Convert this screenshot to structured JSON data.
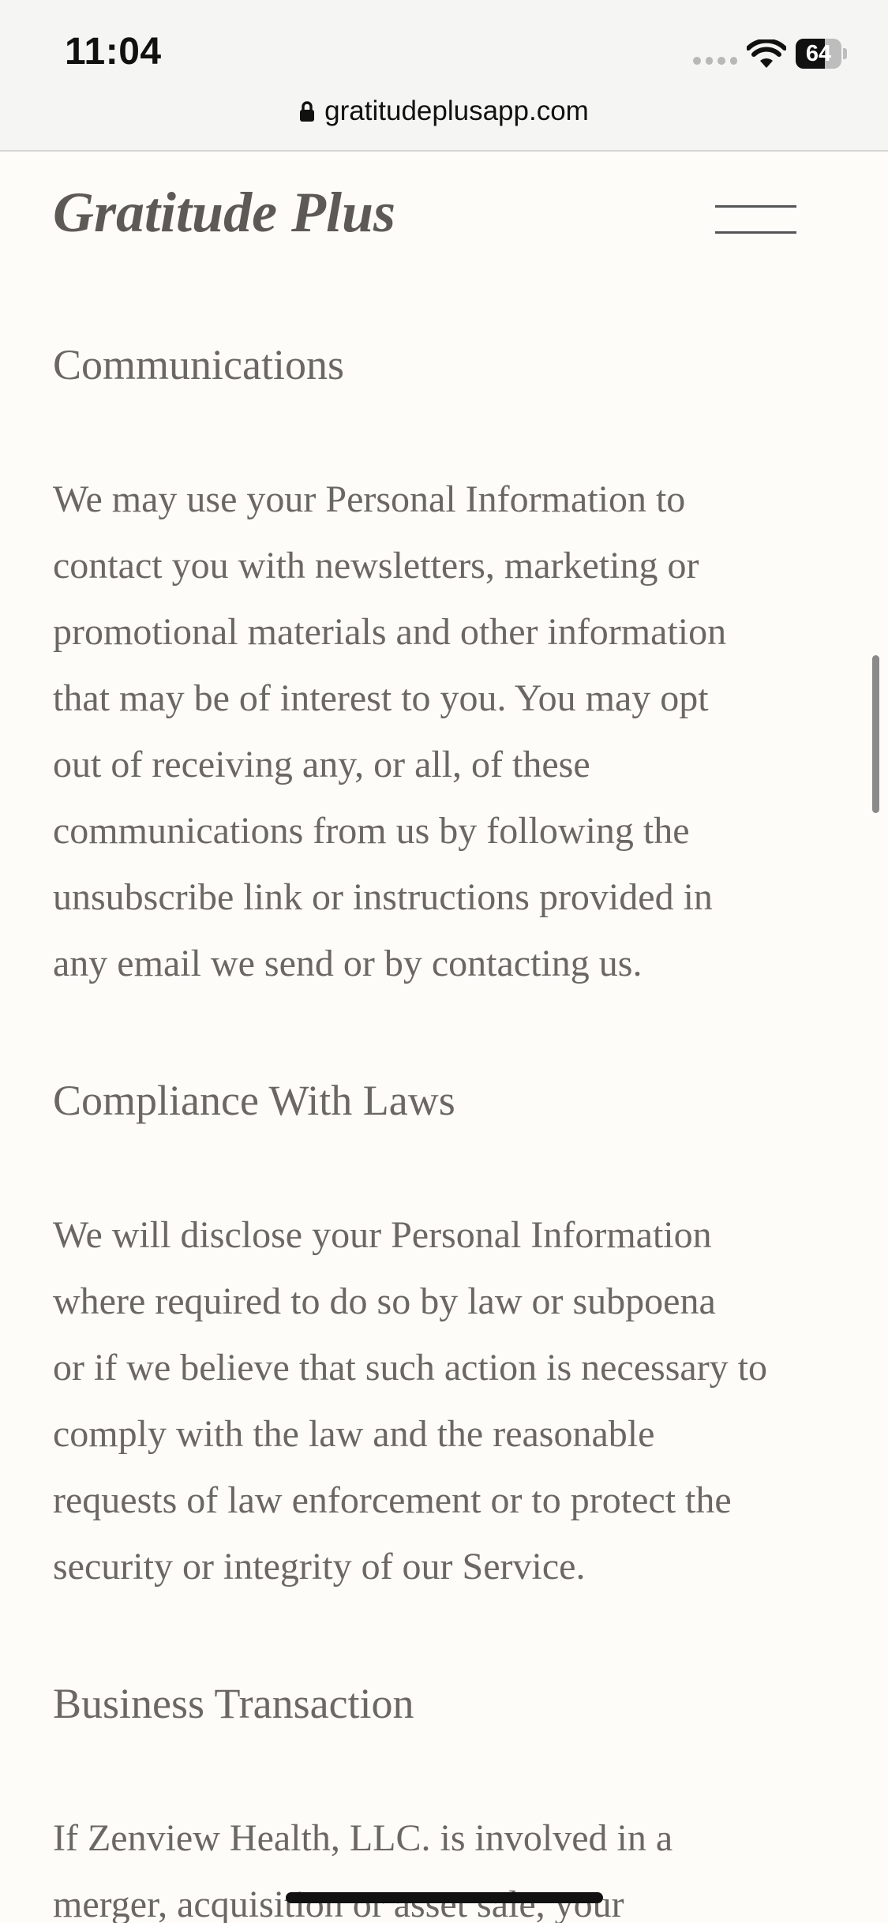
{
  "status_bar": {
    "time": "11:04",
    "battery_level": "64",
    "battery_fraction": 0.64
  },
  "browser": {
    "url": "gratitudeplusapp.com"
  },
  "header": {
    "logo": "Gratitude Plus",
    "menu_icon": "hamburger-menu-icon"
  },
  "sections": [
    {
      "heading": "Communications",
      "lines": [
        "We may use your Personal Information to",
        "contact you with newsletters, marketing or",
        "promotional materials and other information",
        "that may be of interest to you. You may opt",
        "out of receiving any, or all, of these",
        "communications from us by following the",
        "unsubscribe link or instructions provided in",
        "any email we send or by contacting us."
      ]
    },
    {
      "heading": "Compliance With Laws",
      "lines": [
        "We will disclose your Personal Information",
        "where required to do so by law or subpoena",
        "or if we believe that such action is necessary to",
        "comply with the law and the reasonable",
        "requests of law enforcement or to protect the",
        "security or integrity of our Service."
      ]
    },
    {
      "heading": "Business Transaction",
      "lines": [
        "If Zenview Health, LLC. is involved in a",
        "merger, acquisition or asset sale, your"
      ]
    }
  ]
}
